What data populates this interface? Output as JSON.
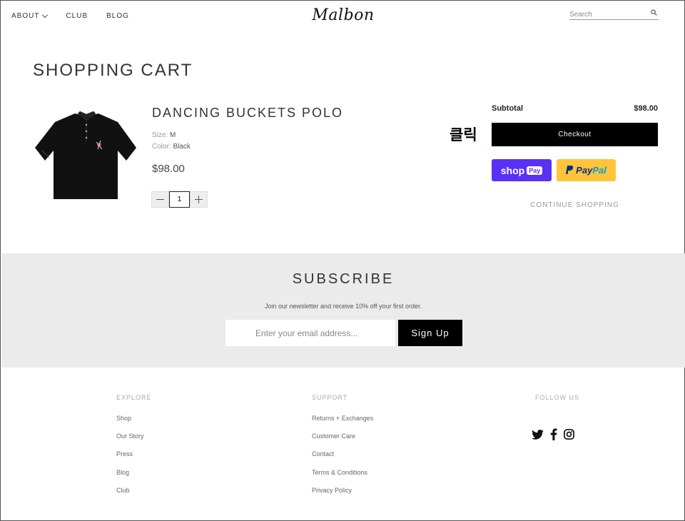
{
  "header": {
    "nav": [
      {
        "label": "ABOUT",
        "has_dropdown": true
      },
      {
        "label": "CLUB"
      },
      {
        "label": "BLOG"
      }
    ],
    "logo": "Malbon",
    "search_placeholder": "Search"
  },
  "cart": {
    "title": "SHOPPING CART",
    "item": {
      "name": "DANCING BUCKETS POLO",
      "size_label": "Size:",
      "size": "M",
      "color_label": "Color:",
      "color": "Black",
      "price": "$98.00",
      "quantity": "1"
    },
    "subtotal_label": "Subtotal",
    "subtotal": "$98.00",
    "annotation": "클릭",
    "checkout_label": "Checkout",
    "shoppay_label": "shop",
    "shoppay_pay": "Pay",
    "paypal_a": "Pay",
    "paypal_b": "Pal",
    "continue_label": "CONTINUE SHOPPING"
  },
  "subscribe": {
    "title": "SUBSCRIBE",
    "text": "Join our newsletter and receive 10% off your first order.",
    "placeholder": "Enter your email address...",
    "button": "Sign Up"
  },
  "footer": {
    "explore": {
      "heading": "EXPLORE",
      "links": [
        "Shop",
        "Our Story",
        "Press",
        "Blog",
        "Club"
      ]
    },
    "support": {
      "heading": "SUPPORT",
      "links": [
        "Returns + Exchanges",
        "Customer Care",
        "Contact",
        "Terms & Conditions",
        "Privacy Policy"
      ]
    },
    "follow": {
      "heading": "FOLLOW US",
      "icons": [
        "twitter-icon",
        "facebook-icon",
        "instagram-icon"
      ]
    }
  },
  "colors": {
    "checkout_bg": "#000000",
    "shoppay_bg": "#5a31f4",
    "paypal_bg": "#ffc439",
    "subscribe_bg": "#ebebeb"
  }
}
